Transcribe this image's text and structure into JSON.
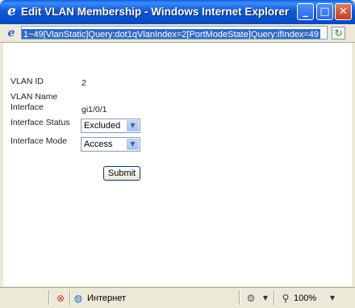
{
  "window": {
    "title": "Edit VLAN Membership - Windows Internet Explorer",
    "minimize_glyph": "_",
    "maximize_glyph": "□",
    "close_glyph": "✕"
  },
  "address": {
    "url": "1~49[VlanStatic]Query:dot1qVlanIndex=2[PortModeState]Query:ifIndex=49"
  },
  "form": {
    "vlan_id_label": "VLAN ID",
    "vlan_id_value": "2",
    "vlan_name_label": "VLAN Name",
    "interface_label": "Interface",
    "interface_value": "gi1/0/1",
    "interface_status_label": "Interface Status",
    "interface_status_value": "Excluded",
    "interface_mode_label": "Interface Mode",
    "interface_mode_value": "Access",
    "submit_label": "Submit"
  },
  "status": {
    "zone_label": "Интернет",
    "zoom_label": "100%"
  },
  "icons": {
    "ie": "ie-logo-icon",
    "page": "page-icon",
    "refresh": "refresh-icon",
    "security": "blocked-icon",
    "globe": "globe-icon",
    "protected": "protected-mode-icon",
    "zoom": "zoom-icon"
  }
}
